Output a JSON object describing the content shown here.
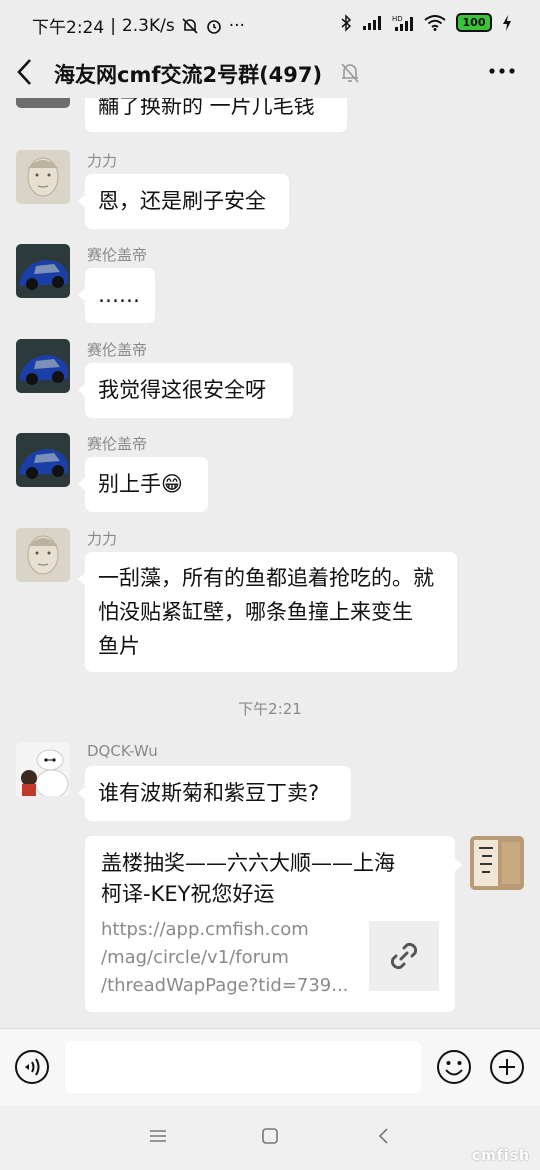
{
  "status_bar": {
    "time": "下午2:24",
    "speed": "2.3K/s",
    "battery": "100",
    "icons": [
      "mute-bell-icon",
      "alarm-icon",
      "more-dots-icon",
      "bluetooth-icon",
      "signal-icon",
      "hd-signal-icon",
      "wifi-icon",
      "battery-icon",
      "charging-icon"
    ]
  },
  "header": {
    "title": "海友网cmf交流2号群(497)",
    "back_icon": "chevron-left-icon",
    "mute_icon": "mute-bell-icon",
    "more_icon": "more-dots-icon"
  },
  "messages": [
    {
      "sender": "",
      "text": "黼了换新的 一片几毛钱",
      "avatar": "person-avatar"
    },
    {
      "sender": "力力",
      "text": "恩，还是刷子安全",
      "avatar": "person-avatar"
    },
    {
      "sender": "赛伦盖帝",
      "text": "……",
      "avatar": "car-avatar"
    },
    {
      "sender": "赛伦盖帝",
      "text": "我觉得这很安全呀",
      "avatar": "car-avatar"
    },
    {
      "sender": "赛伦盖帝",
      "text": "别上手😁",
      "avatar": "car-avatar"
    },
    {
      "sender": "力力",
      "lines": [
        "一刮藻，所有的鱼都追着抢吃的。就",
        "怕没贴紧缸壁，哪条鱼撞上来变生",
        "鱼片"
      ],
      "avatar": "person-avatar"
    },
    {
      "sender": "DQCK-Wu",
      "text": "谁有波斯菊和紫豆丁卖?",
      "avatar": "baymax-avatar"
    }
  ],
  "time_separator": "下午2:21",
  "link_card": {
    "title_lines": [
      "盖楼抽奖——六六大顺——上海",
      "柯译-KEY祝您好运"
    ],
    "url_lines": [
      "https://app.cmfish.com",
      "/mag/circle/v1/forum",
      "/threadWapPage?tid=739..."
    ],
    "thumb_icon": "link-icon"
  },
  "input_bar": {
    "placeholder": "",
    "voice_icon": "voice-icon",
    "emoji_icon": "emoji-icon",
    "plus_icon": "plus-icon"
  },
  "nav_bar": {
    "icons": [
      "menu-icon",
      "home-square-icon",
      "back-arrow-icon"
    ]
  },
  "watermark": "cmfish"
}
